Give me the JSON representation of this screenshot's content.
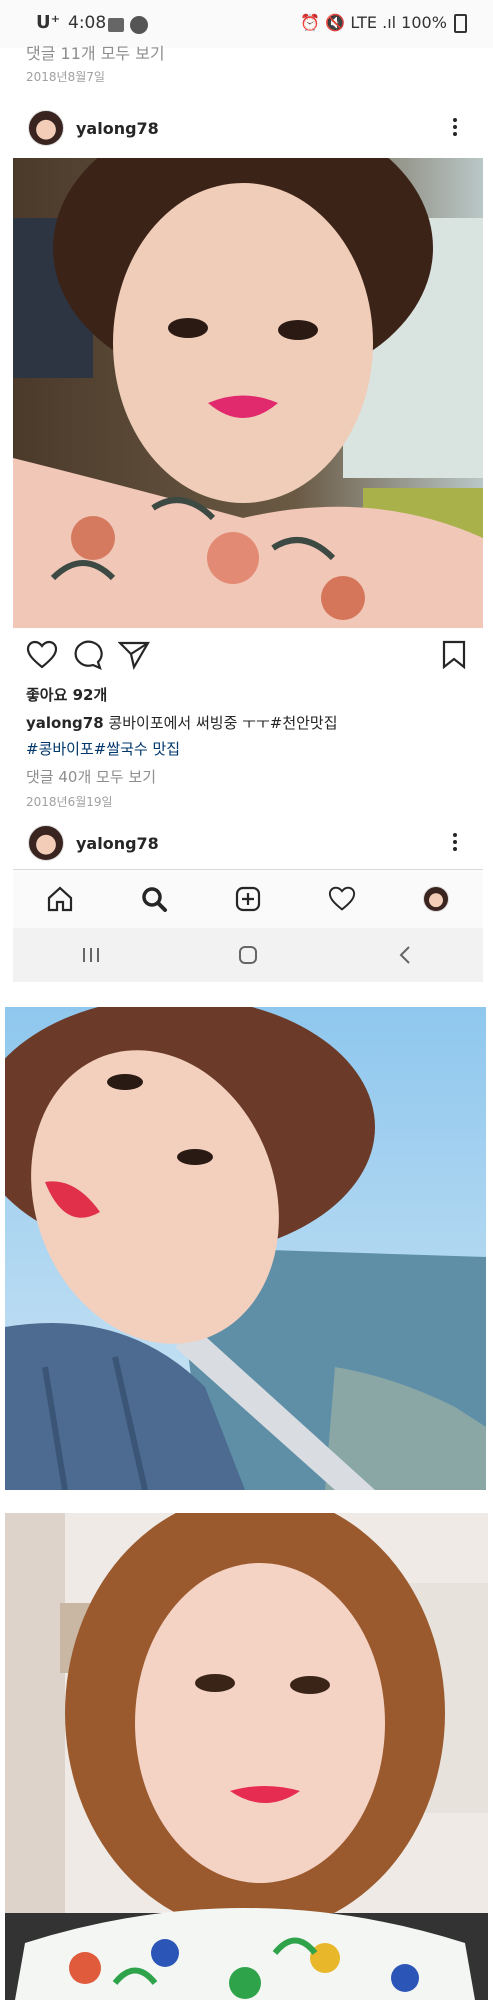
{
  "status_bar": {
    "carrier": "U⁺",
    "time": "4:08",
    "right": "LTE .ıl 100%"
  },
  "previous_post": {
    "comments_link": "댓글 11개 모두 보기",
    "date": "2018년8월7일"
  },
  "post": {
    "username": "yalong78",
    "likes": "좋아요 92개",
    "caption_user": "yalong78",
    "caption_text": "콩바이포에서 써빙중 ㅜㅜ#천안맛집",
    "caption_tags": "#콩바이포#쌀국수 맛집",
    "comments_link": "댓글 40개 모두 보기",
    "date": "2018년6월19일"
  },
  "next_post": {
    "username": "yalong78"
  },
  "tabbar": {
    "items": [
      "home-icon",
      "search-icon",
      "add-icon",
      "heart-icon",
      "profile-avatar"
    ]
  },
  "nav_bar": {
    "items": [
      "recent-apps-icon",
      "home-button-icon",
      "back-icon"
    ]
  },
  "colors": {
    "background": "#ffffff",
    "text": "#262626",
    "muted": "#8e8e8e",
    "navbar": "#f2f2f2"
  }
}
